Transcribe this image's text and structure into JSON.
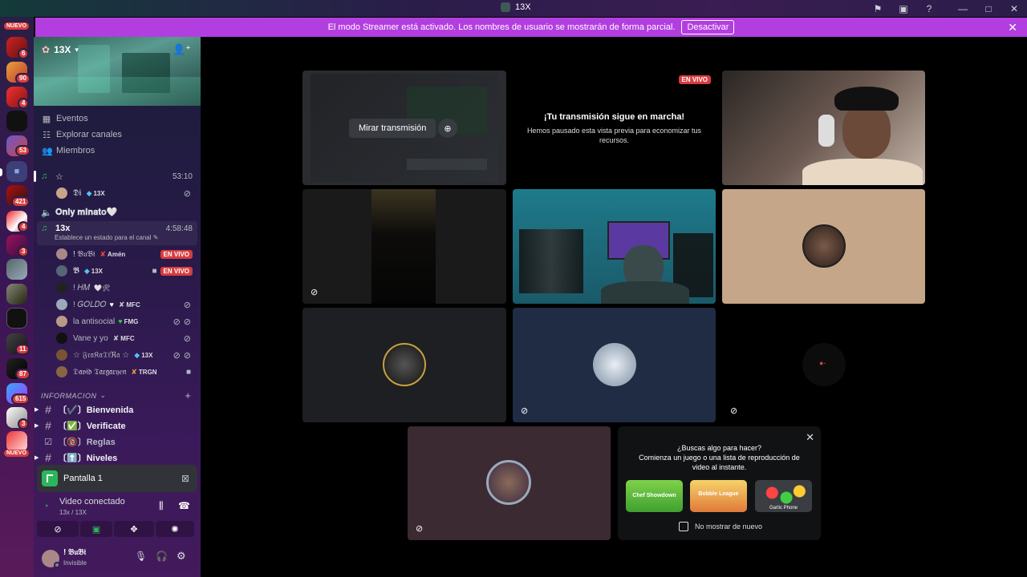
{
  "window": {
    "title": "13X"
  },
  "banner": {
    "text": "El modo Streamer está activado. Los nombres de usuario se mostrarán de forma parcial.",
    "button": "Desactivar"
  },
  "rail": {
    "nuevo_top": "NUEVO",
    "nuevo_bottom": "NUEVO",
    "badges": [
      "6",
      "90",
      "4",
      "53",
      "421",
      "4",
      "3",
      "11",
      "87",
      "615",
      "3"
    ]
  },
  "server": {
    "name": "13X",
    "nav": [
      {
        "label": "Eventos",
        "icon": "calendar-icon"
      },
      {
        "label": "Explorar canales",
        "icon": "browse-icon"
      },
      {
        "label": "Miembros",
        "icon": "members-icon"
      }
    ]
  },
  "voice": {
    "ch1": {
      "name": "☆",
      "time": "53:10",
      "users": [
        {
          "name": "𝕯𝖎",
          "tag": "13X"
        }
      ]
    },
    "ch2": {
      "name": "𝐎𝐧𝐥𝐲 𝐦𝐢𝐧𝐚𝐭𝐨🤍"
    },
    "ch3": {
      "name": "13x",
      "time": "4:58:48",
      "status": "Establece un estado para el canal",
      "users": [
        {
          "name": "! 𝔅𝔲𝔅𝔦",
          "tag": "Amén",
          "live": "EN VIVO"
        },
        {
          "name": "𝕭",
          "tag": "13X",
          "live": "EN VIVO"
        },
        {
          "name": "! 𝐻𝑀",
          "tag": "🤍🛠"
        },
        {
          "name": "! 𝐺𝑂𝐿𝐷𝑂",
          "tag": "MFC"
        },
        {
          "name": "la antisocial",
          "tag": "FMG"
        },
        {
          "name": "Vane y yo",
          "tag": "MFC"
        },
        {
          "name": "☆ 𝔉𝔯𝔞𝔎𝔞𝔗𝔦ℜ𝔞 ☆",
          "tag": "13X"
        },
        {
          "name": "𝔇𝔞𝔳𝔦𝔡 𝔗𝔞𝔯𝔤𝔞𝔯𝔶𝔢𝔫",
          "tag": "TRGN"
        }
      ]
    }
  },
  "category": {
    "name": "INFORMACION"
  },
  "channels": [
    {
      "name": "〔✔️〕Bienvenida"
    },
    {
      "name": "〔✅〕Verificate"
    },
    {
      "name": "〔🔞〕Reglas"
    },
    {
      "name": "〔⬆️〕Niveles"
    }
  ],
  "screen_share": {
    "label": "Pantalla 1"
  },
  "connection": {
    "title": "Video conectado",
    "sub": "13x / 13X"
  },
  "user": {
    "name": "! 𝔅𝔲𝔅𝔦",
    "status": "Invisible"
  },
  "stage": {
    "watch_button": "Mirar transmisión",
    "live_tag": "EN VIVO",
    "paused_title": "¡Tu transmisión sigue en marcha!",
    "paused_body": "Hemos pausado esta vista previa para economizar tus recursos."
  },
  "suggest": {
    "line1": "¿Buscas algo para hacer?",
    "line2": "Comienza un juego o una lista de reproducción de video al instante.",
    "checkbox": "No mostrar de nuevo",
    "games": [
      "Chef Showdown",
      "Bobble League",
      "Gartic Phone"
    ]
  },
  "colors": {
    "accent": "#b23ee0",
    "live": "#d83c3e",
    "connected": "#2db55d"
  }
}
